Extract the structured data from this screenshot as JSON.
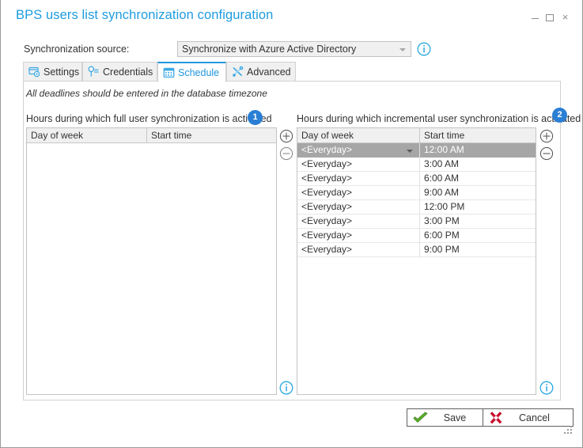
{
  "window": {
    "title": "BPS users list synchronization configuration",
    "controls": {
      "minimize": "minimize-icon",
      "maximize": "maximize-icon",
      "close": "×"
    },
    "accent_color": "#1e9ce0",
    "badge_color": "#2a7fd4"
  },
  "sync_source": {
    "label": "Synchronization source:",
    "selected_value": "Synchronize with Azure Active Directory",
    "options": [
      "Synchronize with Azure Active Directory"
    ],
    "info_icon": "info-icon"
  },
  "tabs": [
    {
      "label": "Settings",
      "icon": "settings-card-icon",
      "active": false
    },
    {
      "label": "Credentials",
      "icon": "key-icon",
      "active": false
    },
    {
      "label": "Schedule",
      "icon": "calendar-icon",
      "active": true
    },
    {
      "label": "Advanced",
      "icon": "tools-icon",
      "active": false
    }
  ],
  "panel": {
    "hint": "All deadlines should be entered in the database timezone",
    "full_sync": {
      "caption": "Hours during which full user synchronization is activated",
      "badge": "1",
      "columns": [
        "Day of week",
        "Start time"
      ],
      "rows": [],
      "add_label": "plus-icon",
      "remove_label": "minus-icon",
      "info_icon": "info-icon"
    },
    "incremental_sync": {
      "caption": "Hours during which incremental user synchronization is activated",
      "badge": "2",
      "columns": [
        "Day of week",
        "Start time"
      ],
      "rows": [
        {
          "day": "<Everyday>",
          "time": "12:00 AM",
          "selected": true
        },
        {
          "day": "<Everyday>",
          "time": "3:00 AM",
          "selected": false
        },
        {
          "day": "<Everyday>",
          "time": "6:00 AM",
          "selected": false
        },
        {
          "day": "<Everyday>",
          "time": "9:00 AM",
          "selected": false
        },
        {
          "day": "<Everyday>",
          "time": "12:00 PM",
          "selected": false
        },
        {
          "day": "<Everyday>",
          "time": "3:00 PM",
          "selected": false
        },
        {
          "day": "<Everyday>",
          "time": "6:00 PM",
          "selected": false
        },
        {
          "day": "<Everyday>",
          "time": "9:00 PM",
          "selected": false
        }
      ],
      "add_label": "plus-icon",
      "remove_label": "minus-icon",
      "info_icon": "info-icon"
    }
  },
  "footer": {
    "save_label": "Save",
    "save_icon": "green-check-icon",
    "cancel_label": "Cancel",
    "cancel_icon": "red-cross-icon"
  }
}
